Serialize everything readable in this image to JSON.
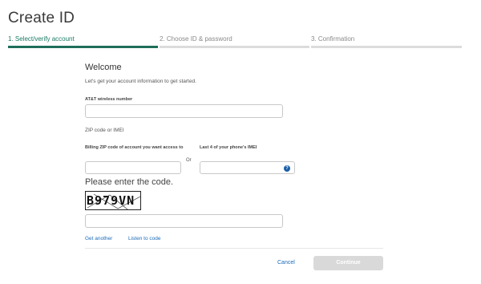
{
  "header": {
    "title": "Create ID"
  },
  "steps": [
    {
      "label": "1. Select/verify account",
      "active": true
    },
    {
      "label": "2. Choose ID & password",
      "active": false
    },
    {
      "label": "3. Confirmation",
      "active": false
    }
  ],
  "form": {
    "welcome": "Welcome",
    "intro": "Let's get your account information to get started.",
    "phone_label": "AT&T wireless number",
    "phone_value": "",
    "zip_heading": "ZIP code or IMEI",
    "zip_label": "Billing ZIP code of account you want access to",
    "zip_value": "",
    "or_text": "Or",
    "imei_label": "Last 4 of your phone's IMEI",
    "imei_value": "",
    "help_icon_glyph": "?",
    "captcha_prompt": "Please enter the code.",
    "captcha_text": "B979VN",
    "captcha_value": ""
  },
  "links": {
    "get_another": "Get another",
    "listen": "Listen to code"
  },
  "actions": {
    "cancel": "Cancel",
    "continue": "Continue"
  },
  "colors": {
    "active_step": "#1e6e5b",
    "link": "#1a6bb8",
    "disabled_button": "#d9d9d9",
    "help_icon": "#1a5fa8"
  }
}
